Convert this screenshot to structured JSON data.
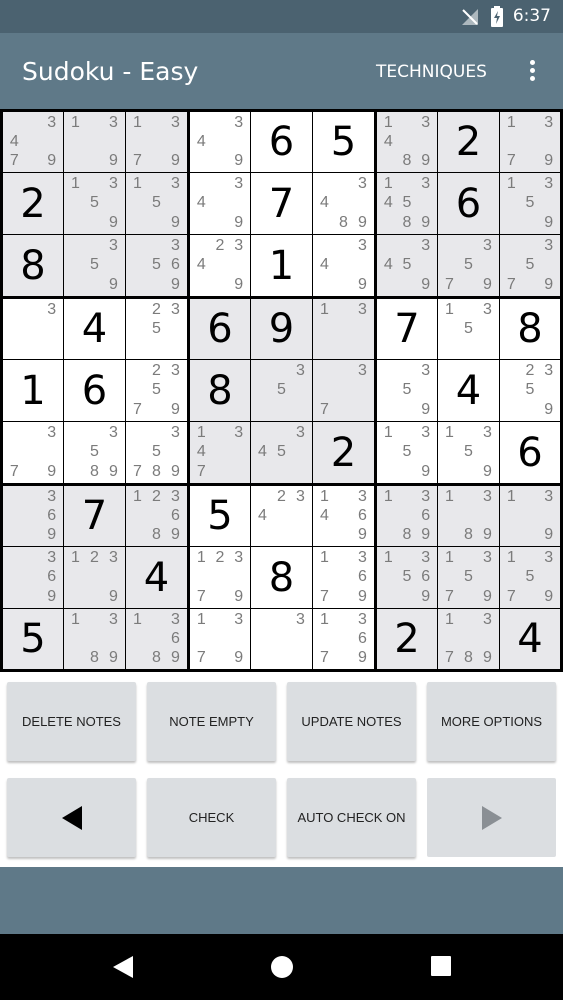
{
  "status_bar": {
    "time": "6:37",
    "signal_icon": "signal-off-icon",
    "battery_icon": "battery-charging-icon"
  },
  "app_bar": {
    "title": "Sudoku - Easy",
    "techniques_label": "TECHNIQUES",
    "menu_icon": "more-vert-icon"
  },
  "colors": {
    "status_bar": "#4b6270",
    "app_bar": "#5f7988",
    "cell_grey": "#e8e8eb",
    "button": "#dbdee1"
  },
  "board": {
    "cells": [
      [
        {
          "n": [
            3,
            4,
            7,
            9
          ],
          "g": 1
        },
        {
          "n": [
            1,
            3,
            9
          ],
          "g": 1
        },
        {
          "n": [
            1,
            3,
            7,
            9
          ],
          "g": 1
        },
        {
          "n": [
            3,
            4,
            9
          ],
          "g": 0
        },
        {
          "v": "6",
          "g": 0
        },
        {
          "v": "5",
          "g": 0
        },
        {
          "n": [
            1,
            3,
            4,
            8,
            9
          ],
          "g": 1
        },
        {
          "v": "2",
          "g": 1
        },
        {
          "n": [
            1,
            3,
            7,
            9
          ],
          "g": 1
        }
      ],
      [
        {
          "v": "2",
          "g": 1
        },
        {
          "n": [
            1,
            3,
            5,
            9
          ],
          "g": 1
        },
        {
          "n": [
            1,
            3,
            5,
            9
          ],
          "g": 1
        },
        {
          "n": [
            3,
            4,
            9
          ],
          "g": 0
        },
        {
          "v": "7",
          "g": 0
        },
        {
          "n": [
            3,
            4,
            8,
            9
          ],
          "g": 0
        },
        {
          "n": [
            1,
            3,
            4,
            5,
            8,
            9
          ],
          "g": 1
        },
        {
          "v": "6",
          "g": 1
        },
        {
          "n": [
            1,
            3,
            5,
            9
          ],
          "g": 1
        }
      ],
      [
        {
          "v": "8",
          "g": 1
        },
        {
          "n": [
            3,
            5,
            9
          ],
          "g": 1
        },
        {
          "n": [
            3,
            5,
            6,
            9
          ],
          "g": 1
        },
        {
          "n": [
            2,
            3,
            4,
            9
          ],
          "g": 0
        },
        {
          "v": "1",
          "g": 0
        },
        {
          "n": [
            3,
            4,
            9
          ],
          "g": 0
        },
        {
          "n": [
            3,
            4,
            5,
            9
          ],
          "g": 1
        },
        {
          "n": [
            3,
            5,
            7,
            9
          ],
          "g": 1
        },
        {
          "n": [
            3,
            5,
            7,
            9
          ],
          "g": 1
        }
      ],
      [
        {
          "n": [
            3
          ],
          "g": 0
        },
        {
          "v": "4",
          "g": 0
        },
        {
          "n": [
            2,
            3,
            5
          ],
          "g": 0
        },
        {
          "v": "6",
          "g": 1
        },
        {
          "v": "9",
          "g": 1
        },
        {
          "n": [
            1,
            3
          ],
          "g": 1
        },
        {
          "v": "7",
          "g": 0
        },
        {
          "n": [
            1,
            3,
            5
          ],
          "g": 0
        },
        {
          "v": "8",
          "g": 0
        }
      ],
      [
        {
          "v": "1",
          "g": 0
        },
        {
          "v": "6",
          "g": 0
        },
        {
          "n": [
            2,
            3,
            5,
            7,
            9
          ],
          "g": 0
        },
        {
          "v": "8",
          "g": 1
        },
        {
          "n": [
            3,
            5
          ],
          "g": 1
        },
        {
          "n": [
            3,
            7
          ],
          "g": 1
        },
        {
          "n": [
            3,
            5,
            9
          ],
          "g": 0
        },
        {
          "v": "4",
          "g": 0
        },
        {
          "n": [
            2,
            3,
            5,
            9
          ],
          "g": 0
        }
      ],
      [
        {
          "n": [
            3,
            7,
            9
          ],
          "g": 0
        },
        {
          "n": [
            3,
            5,
            8,
            9
          ],
          "g": 0
        },
        {
          "n": [
            3,
            5,
            7,
            8,
            9
          ],
          "g": 0
        },
        {
          "n": [
            1,
            3,
            4,
            7
          ],
          "g": 1
        },
        {
          "n": [
            3,
            4,
            5
          ],
          "g": 1
        },
        {
          "v": "2",
          "g": 1
        },
        {
          "n": [
            1,
            3,
            5,
            9
          ],
          "g": 0
        },
        {
          "n": [
            1,
            3,
            5,
            9
          ],
          "g": 0
        },
        {
          "v": "6",
          "g": 0
        }
      ],
      [
        {
          "n": [
            3,
            6,
            9
          ],
          "g": 1
        },
        {
          "v": "7",
          "g": 1
        },
        {
          "n": [
            1,
            2,
            3,
            6,
            8,
            9
          ],
          "g": 1
        },
        {
          "v": "5",
          "g": 0
        },
        {
          "n": [
            2,
            3,
            4
          ],
          "g": 0
        },
        {
          "n": [
            1,
            3,
            4,
            6,
            9
          ],
          "g": 0
        },
        {
          "n": [
            1,
            3,
            6,
            8,
            9
          ],
          "g": 1
        },
        {
          "n": [
            1,
            3,
            8,
            9
          ],
          "g": 1
        },
        {
          "n": [
            1,
            3,
            9
          ],
          "g": 1
        }
      ],
      [
        {
          "n": [
            3,
            6,
            9
          ],
          "g": 1
        },
        {
          "n": [
            1,
            2,
            3,
            9
          ],
          "g": 1
        },
        {
          "v": "4",
          "g": 1
        },
        {
          "n": [
            1,
            2,
            3,
            7,
            9
          ],
          "g": 0
        },
        {
          "v": "8",
          "g": 0
        },
        {
          "n": [
            1,
            3,
            6,
            7,
            9
          ],
          "g": 0
        },
        {
          "n": [
            1,
            3,
            5,
            6,
            9
          ],
          "g": 1
        },
        {
          "n": [
            1,
            3,
            5,
            7,
            9
          ],
          "g": 1
        },
        {
          "n": [
            1,
            3,
            5,
            7,
            9
          ],
          "g": 1
        }
      ],
      [
        {
          "v": "5",
          "g": 1
        },
        {
          "n": [
            1,
            3,
            8,
            9
          ],
          "g": 1
        },
        {
          "n": [
            1,
            3,
            6,
            8,
            9
          ],
          "g": 1
        },
        {
          "n": [
            1,
            3,
            7,
            9
          ],
          "g": 0
        },
        {
          "n": [
            3
          ],
          "g": 0
        },
        {
          "n": [
            1,
            3,
            6,
            7,
            9
          ],
          "g": 0
        },
        {
          "v": "2",
          "g": 1
        },
        {
          "n": [
            1,
            3,
            7,
            8,
            9
          ],
          "g": 1
        },
        {
          "v": "4",
          "g": 1
        }
      ]
    ]
  },
  "buttons": {
    "delete_notes": "DELETE NOTES",
    "note_empty": "NOTE EMPTY",
    "update_notes": "UPDATE NOTES",
    "more_options": "MORE OPTIONS",
    "check": "CHECK",
    "auto_check": "AUTO CHECK ON",
    "prev_icon": "arrow-left-icon",
    "next_icon": "arrow-right-icon"
  },
  "nav_bar": {
    "back_icon": "back-triangle-icon",
    "home_icon": "home-circle-icon",
    "recents_icon": "recents-square-icon"
  }
}
